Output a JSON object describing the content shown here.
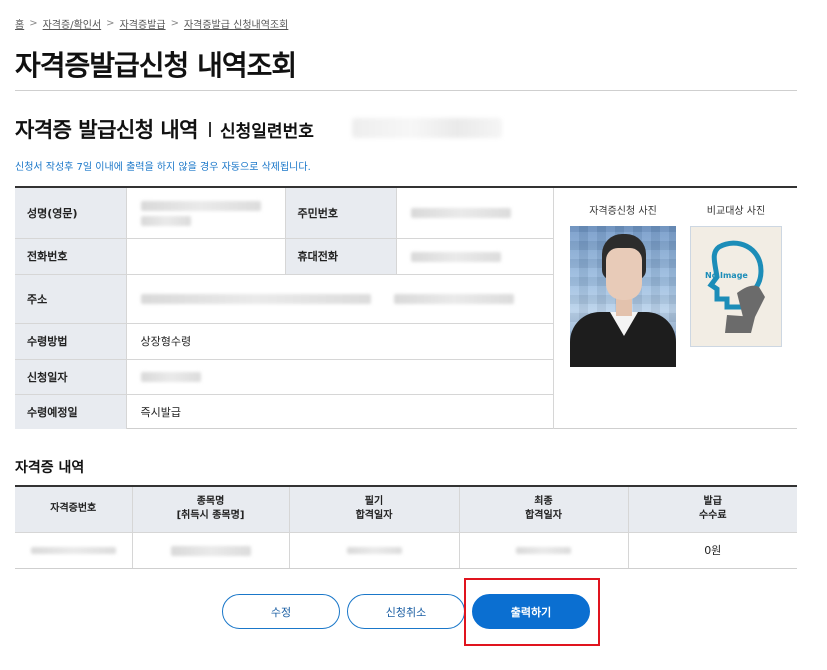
{
  "breadcrumb": {
    "items": [
      "홈",
      "자격증/확인서",
      "자격증발급",
      "자격증발급 신청내역조회"
    ],
    "separator": ">"
  },
  "page": {
    "title": "자격증발급신청 내역조회"
  },
  "section": {
    "title": "자격증 발급신청 내역",
    "serial_label": "신청일련번호"
  },
  "notice": "신청서 작성후 7일 이내에 출력을 하지 않을 경우 자동으로 삭제됩니다.",
  "info": {
    "name_label": "성명(영문)",
    "resident_no_label": "주민번호",
    "phone_label": "전화번호",
    "mobile_label": "휴대전화",
    "address_label": "주소",
    "receive_method_label": "수령방법",
    "receive_method_value": "상장형수령",
    "apply_date_label": "신청일자",
    "expected_date_label": "수령예정일",
    "expected_date_value": "즉시발급"
  },
  "photos": {
    "applicant_label": "자격증신청 사진",
    "compare_label": "비교대상 사진",
    "no_image_text": "No Image"
  },
  "cert_section": {
    "title": "자격증 내역",
    "headers": [
      {
        "line1": "자격증번호",
        "line2": ""
      },
      {
        "line1": "종목명",
        "line2": "[취득시 종목명]"
      },
      {
        "line1": "필기",
        "line2": "합격일자"
      },
      {
        "line1": "최종",
        "line2": "합격일자"
      },
      {
        "line1": "발급",
        "line2": "수수료"
      }
    ],
    "fee_value": "0원"
  },
  "buttons": {
    "edit": "수정",
    "cancel": "신청취소",
    "print": "출력하기"
  },
  "colors": {
    "accent": "#0b6fd1",
    "highlight": "#e0141e",
    "header_bg": "#e8ebf0",
    "notice": "#1a77c9"
  }
}
